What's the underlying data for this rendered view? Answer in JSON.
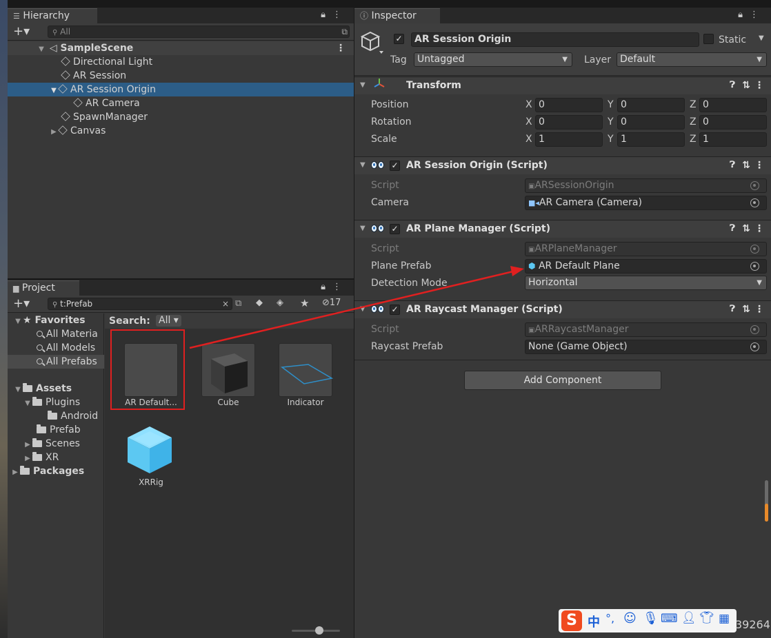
{
  "hierarchy": {
    "tab_label": "Hierarchy",
    "search_placeholder": "All",
    "scene": "SampleScene",
    "items": [
      {
        "label": "Directional Light"
      },
      {
        "label": "AR Session"
      },
      {
        "label": "AR Session Origin"
      },
      {
        "label": "AR Camera"
      },
      {
        "label": "SpawnManager"
      },
      {
        "label": "Canvas"
      }
    ]
  },
  "project": {
    "tab_label": "Project",
    "search_value": "t:Prefab",
    "hidden_count": "17",
    "search_label": "Search:",
    "search_scope": "All",
    "tree": {
      "favorites": "Favorites",
      "fav_items": [
        "All Materia",
        "All Models",
        "All Prefabs"
      ],
      "assets": "Assets",
      "asset_items": [
        "Plugins",
        "Android",
        "Prefab",
        "Scenes",
        "XR"
      ],
      "packages": "Packages"
    },
    "assets_grid": [
      {
        "label": "AR Default..."
      },
      {
        "label": "Cube"
      },
      {
        "label": "Indicator"
      },
      {
        "label": "XRRig"
      }
    ]
  },
  "inspector": {
    "tab_label": "Inspector",
    "object_name": "AR Session Origin",
    "static_label": "Static",
    "tag_label": "Tag",
    "tag_value": "Untagged",
    "layer_label": "Layer",
    "layer_value": "Default",
    "transform": {
      "title": "Transform",
      "rows": [
        {
          "label": "Position",
          "x": "0",
          "y": "0",
          "z": "0"
        },
        {
          "label": "Rotation",
          "x": "0",
          "y": "0",
          "z": "0"
        },
        {
          "label": "Scale",
          "x": "1",
          "y": "1",
          "z": "1"
        }
      ],
      "axis": [
        "X",
        "Y",
        "Z"
      ]
    },
    "session_origin": {
      "title": "AR Session Origin (Script)",
      "script_label": "Script",
      "script_value": "ARSessionOrigin",
      "camera_label": "Camera",
      "camera_value": "AR Camera (Camera)"
    },
    "plane_manager": {
      "title": "AR Plane Manager (Script)",
      "script_label": "Script",
      "script_value": "ARPlaneManager",
      "prefab_label": "Plane Prefab",
      "prefab_value": "AR Default Plane",
      "mode_label": "Detection Mode",
      "mode_value": "Horizontal"
    },
    "raycast_manager": {
      "title": "AR Raycast Manager (Script)",
      "script_label": "Script",
      "script_value": "ARRaycastManager",
      "prefab_label": "Raycast Prefab",
      "prefab_value": "None (Game Object)"
    },
    "add_component": "Add Component"
  },
  "ime": {
    "lang": "中",
    "watermark": "39264"
  },
  "colors": {
    "selection": "#2c5d87",
    "annotation": "#e02020"
  }
}
